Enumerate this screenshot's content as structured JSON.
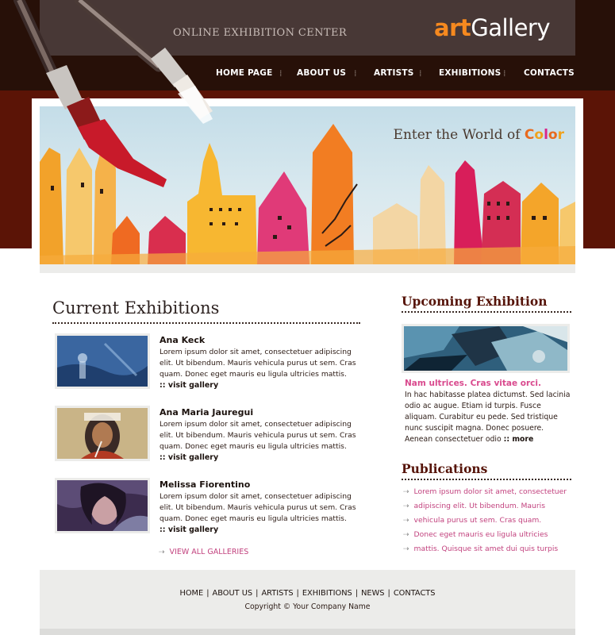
{
  "header": {
    "tagline": "ONLINE EXHIBITION CENTER",
    "logo_art": "art",
    "logo_gallery": "Gallery",
    "nav": [
      "HOME PAGE",
      "ABOUT US",
      "ARTISTS",
      "EXHIBITIONS",
      "CONTACTS"
    ]
  },
  "banner": {
    "headline_prefix": "Enter the World of ",
    "color_word": [
      "C",
      "o",
      "l",
      "o",
      "r"
    ],
    "color_word_colors": [
      "#e86a1e",
      "#f0a21c",
      "#d9268a",
      "#e86a1e",
      "#f0a21c"
    ]
  },
  "current": {
    "title": "Current Exhibitions",
    "items": [
      {
        "name": "Ana Keck",
        "desc": "Lorem ipsum dolor sit amet, consectetuer adipiscing elit. Ut bibendum. Mauris vehicula purus ut sem. Cras quam. Donec eget mauris eu ligula ultricies mattis.",
        "link": ":: visit gallery"
      },
      {
        "name": "Ana Maria Jauregui",
        "desc": "Lorem ipsum dolor sit amet, consectetuer adipiscing elit. Ut bibendum. Mauris vehicula purus ut sem. Cras quam. Donec eget mauris eu ligula ultricies mattis.",
        "link": ":: visit gallery"
      },
      {
        "name": "Melissa Fiorentino",
        "desc": "Lorem ipsum dolor sit amet, consectetuer adipiscing elit. Ut bibendum. Mauris vehicula purus ut sem. Cras quam. Donec eget mauris eu ligula ultricies mattis.",
        "link": ":: visit gallery"
      }
    ],
    "view_all": "VIEW ALL GALLERIES"
  },
  "upcoming": {
    "title": "Upcoming Exhibition",
    "headline": "Nam ultrices. Cras vitae orci.",
    "text": "In hac habitasse platea dictumst. Sed lacinia odio ac augue. Etiam id turpis. Fusce aliquam. Curabitur eu pede. Sed tristique nunc suscipit magna. Donec posuere. Aenean consectetuer odio",
    "more": ":: more"
  },
  "publications": {
    "title": "Publications",
    "items": [
      "Lorem ipsum dolor sit amet, consectetuer",
      "adipiscing elit. Ut bibendum. Mauris",
      "vehicula purus ut sem. Cras quam.",
      "Donec eget mauris eu ligula ultricies",
      "mattis. Quisque sit amet dui quis turpis"
    ]
  },
  "footer": {
    "links": [
      "HOME",
      "ABOUT US",
      "ARTISTS",
      "EXHIBITIONS",
      "NEWS",
      "CONTACTS"
    ],
    "separator": "|",
    "copyright": "Copyright © Your Company Name"
  }
}
